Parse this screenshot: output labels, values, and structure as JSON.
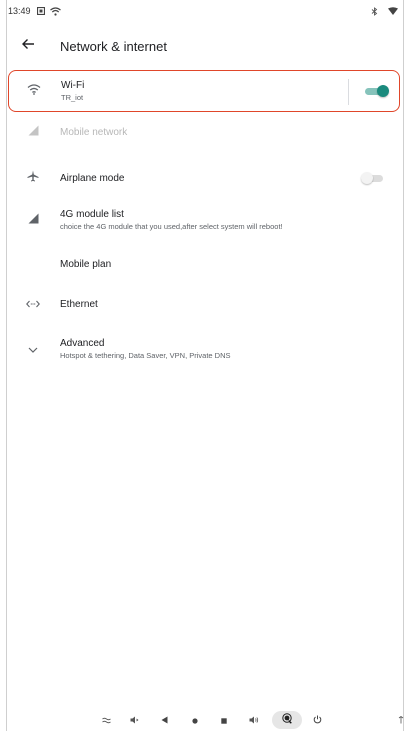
{
  "status_bar": {
    "time": "13:49",
    "left_icons": [
      "notification-square-icon",
      "wifi-status-icon"
    ],
    "right_icons": [
      "bluetooth-icon",
      "wifi-signal-icon"
    ]
  },
  "app_bar": {
    "back_icon": "arrow-back-icon",
    "title": "Network & internet"
  },
  "items": {
    "wifi": {
      "title": "Wi-Fi",
      "subtitle": "TR_iot",
      "toggle": "on",
      "icon": "wifi-icon"
    },
    "mobile_network": {
      "title": "Mobile network",
      "icon": "cellular-signal-icon",
      "disabled": true
    },
    "airplane_mode": {
      "title": "Airplane mode",
      "toggle": "off",
      "icon": "airplane-icon"
    },
    "module_list": {
      "title": "4G module list",
      "subtitle": "choice the 4G module that you used,after select system will reboot!",
      "icon": "cellular-signal-icon"
    },
    "mobile_plan": {
      "title": "Mobile plan"
    },
    "ethernet": {
      "title": "Ethernet",
      "icon": "ethernet-icon"
    },
    "advanced": {
      "title": "Advanced",
      "subtitle": "Hotspot & tethering, Data Saver, VPN, Private DNS",
      "icon": "chevron-down-icon"
    }
  },
  "nav_bar": {
    "icons": [
      "screenshot-icon",
      "volume-down-icon",
      "back-triangle-icon",
      "home-circle-icon",
      "recents-square-icon",
      "volume-up-icon",
      "screen-record-icon",
      "power-icon",
      "overflow-icon"
    ]
  },
  "colors": {
    "accent": "#1a8a7d",
    "highlight_border": "#e0462a"
  }
}
